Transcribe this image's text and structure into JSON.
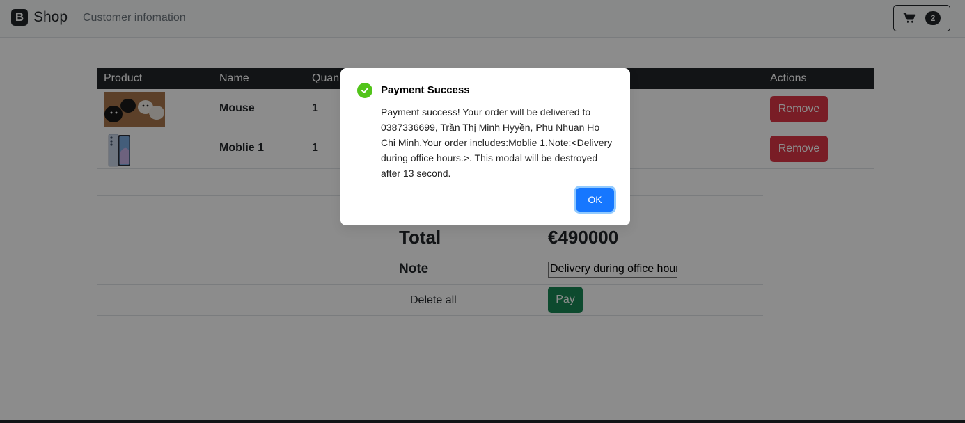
{
  "navbar": {
    "brand_logo": "B",
    "brand_text": "Shop",
    "nav_link": "Customer infomation",
    "cart_count": "2"
  },
  "table": {
    "headers": [
      "Product",
      "Name",
      "Quan",
      "Actions"
    ],
    "rows": [
      {
        "name": "Mouse",
        "quantity": "1",
        "action": "Remove"
      },
      {
        "name": "Moblie 1",
        "quantity": "1",
        "action": "Remove"
      }
    ]
  },
  "summary": {
    "total_label": "Total",
    "total_value": "€490000",
    "note_label": "Note",
    "note_value": "Delivery during office hours.",
    "delete_all": "Delete all",
    "pay": "Pay"
  },
  "modal": {
    "title": "Payment Success",
    "message": "Payment success! Your order will be delivered to 0387336699, Trần Thị Minh Hyyền, Phu Nhuan Ho Chi Minh.Your order includes:Moblie 1.Note:<Delivery during office hours.>. This modal will be destroyed after 13 second.",
    "ok": "OK"
  }
}
